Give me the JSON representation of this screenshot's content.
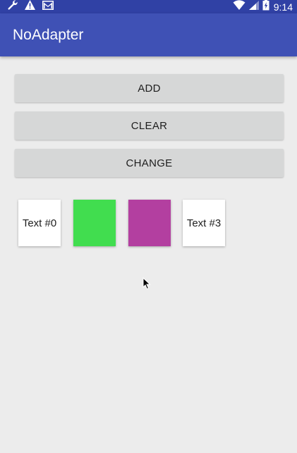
{
  "status_bar": {
    "time": "9:14",
    "left_icons": [
      "wrench-icon",
      "warning-icon",
      "gmail-icon"
    ],
    "right_icons": [
      "wifi-icon",
      "signal-icon",
      "battery-icon"
    ]
  },
  "app_bar": {
    "title": "NoAdapter"
  },
  "buttons": {
    "add": "ADD",
    "clear": "CLEAR",
    "change": "CHANGE"
  },
  "tiles": [
    {
      "type": "text",
      "label": "Text #0",
      "color": "#ffffff"
    },
    {
      "type": "color",
      "label": "",
      "color": "#41dd4f"
    },
    {
      "type": "color",
      "label": "",
      "color": "#b33fa0"
    },
    {
      "type": "text",
      "label": "Text #3",
      "color": "#ffffff"
    }
  ],
  "colors": {
    "status_bar": "#3041a5",
    "app_bar": "#3f51b5",
    "background": "#ececec",
    "button": "#d6d7d7"
  }
}
